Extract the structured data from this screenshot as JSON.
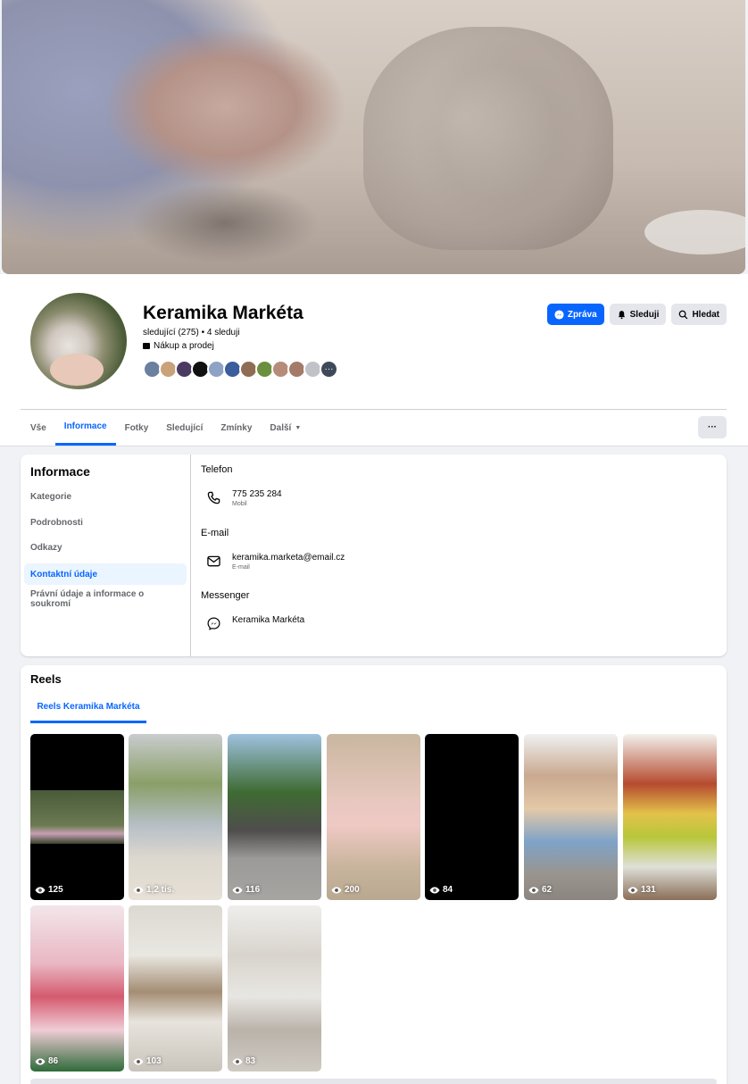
{
  "page": {
    "name": "Keramika Markéta",
    "followers_line": "sledující (275) • 4 sleduji",
    "category": "Nákup a prodej",
    "friend_more": "···"
  },
  "actions": {
    "message": "Zpráva",
    "following": "Sleduji",
    "search": "Hledat"
  },
  "tabs": [
    {
      "label": "Vše"
    },
    {
      "label": "Informace"
    },
    {
      "label": "Fotky"
    },
    {
      "label": "Sledující"
    },
    {
      "label": "Zmínky"
    },
    {
      "label": "Další"
    }
  ],
  "more_button": "···",
  "about": {
    "title": "Informace",
    "nav": [
      {
        "label": "Kategorie"
      },
      {
        "label": "Podrobnosti"
      },
      {
        "label": "Odkazy"
      },
      {
        "label": "Kontaktní údaje"
      },
      {
        "label": "Právní údaje a informace o soukromí"
      }
    ],
    "phone_title": "Telefon",
    "phone": "775 235 284",
    "phone_type": "Mobil",
    "email_title": "E-mail",
    "email": "keramika.marketa@email.cz",
    "email_type": "E-mail",
    "messenger_title": "Messenger",
    "messenger": "Keramika Markéta"
  },
  "reels": {
    "title": "Reels",
    "tab": "Reels Keramika Markéta",
    "items": [
      {
        "views": "125"
      },
      {
        "views": "1,2 tis."
      },
      {
        "views": "116"
      },
      {
        "views": "200"
      },
      {
        "views": "84"
      },
      {
        "views": "62"
      },
      {
        "views": "131"
      },
      {
        "views": "86"
      },
      {
        "views": "103"
      },
      {
        "views": "83"
      }
    ]
  },
  "colors": {
    "accent": "#0866ff",
    "accent_bg": "#ebf5ff",
    "secondary_button": "#e4e6eb",
    "page_bg": "#f0f2f5"
  }
}
